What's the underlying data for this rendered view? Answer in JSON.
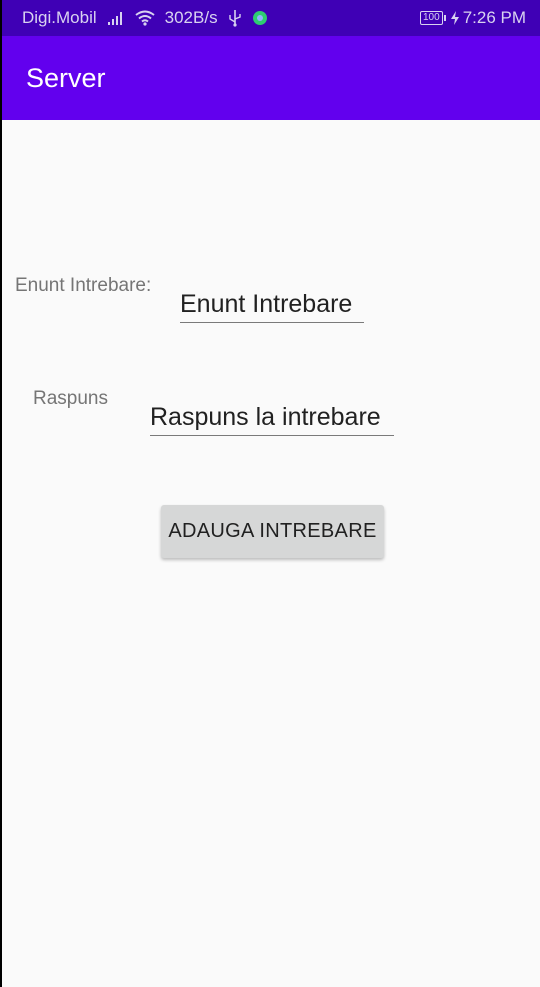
{
  "status_bar": {
    "carrier": "Digi.Mobil",
    "net_speed": "302B/s",
    "battery": "100",
    "time": "7:26 PM",
    "icons": [
      "signal-icon",
      "wifi-icon",
      "usb-icon",
      "app-notification-icon",
      "battery-icon",
      "charging-icon"
    ]
  },
  "toolbar": {
    "title": "Server"
  },
  "form": {
    "question_label": "Enunt Intrebare:",
    "question_field": "Enunt Intrebare",
    "answer_label": "Raspuns",
    "answer_field": "Raspuns la intrebare",
    "submit_button": "ADAUGA INTREBARE"
  },
  "colors": {
    "status_bar": "#3f00b5",
    "toolbar": "#6200ee",
    "background": "#fafafa",
    "button": "#d6d7d7"
  }
}
